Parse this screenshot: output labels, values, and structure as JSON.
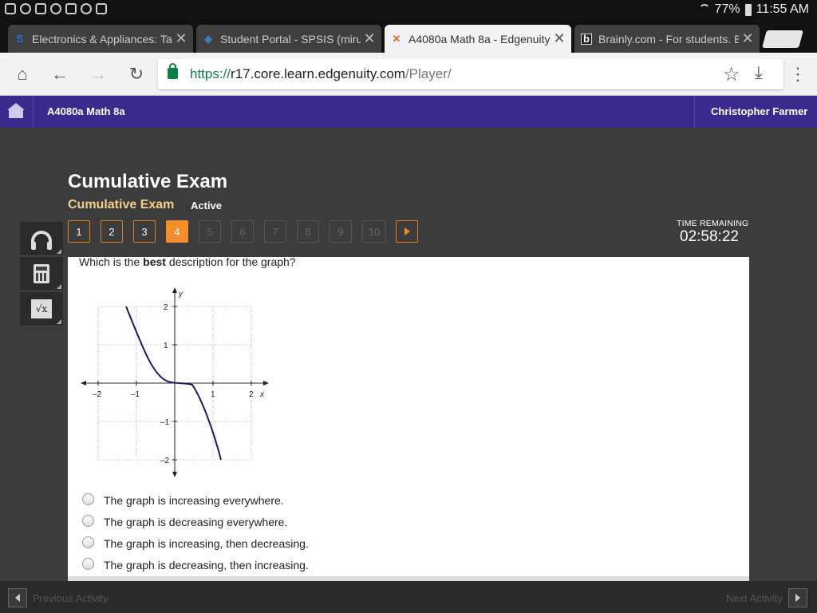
{
  "status_bar": {
    "battery": "77%",
    "time": "11:55 AM",
    "icons": [
      "notification-icon",
      "wrestling-app-icon",
      "gallery-icon",
      "game-icon",
      "flipboard-icon",
      "instagram-icon",
      "bag-icon"
    ]
  },
  "tabs": [
    {
      "title": "Electronics & Appliances: Ta",
      "favicon": "S",
      "active": false
    },
    {
      "title": "Student Portal - SPSIS (miru",
      "favicon": "shield",
      "active": false
    },
    {
      "title": "A4080a Math 8a - Edgenuity",
      "favicon": "X",
      "active": true
    },
    {
      "title": "Brainly.com - For students. B",
      "favicon": "b",
      "active": false
    }
  ],
  "address": {
    "protocol": "https://",
    "host": "r17.core.learn.edgenuity.com",
    "path": "/Player/"
  },
  "appbar": {
    "course": "A4080a Math 8a",
    "user": "Christopher Farmer"
  },
  "player": {
    "title": "Cumulative Exam",
    "subtitle": "Cumulative Exam",
    "status": "Active",
    "questions": [
      "1",
      "2",
      "3",
      "4",
      "5",
      "6",
      "7",
      "8",
      "9",
      "10"
    ],
    "current_question": 4,
    "answered_count": 3,
    "timer_label": "TIME REMAINING",
    "timer": "02:58:22"
  },
  "tools": [
    "headphones-icon",
    "calculator-icon",
    "formula-icon"
  ],
  "question": {
    "before": "Which is the ",
    "emphasis": "best",
    "after": " description for the graph?"
  },
  "graph": {
    "x_label": "x",
    "y_label": "y",
    "x_ticks": [
      "–2",
      "–1",
      "1",
      "2"
    ],
    "y_ticks": [
      "2",
      "1",
      "–1",
      "–2"
    ],
    "curve_color": "#1a1a5e"
  },
  "options": [
    "The graph is increasing everywhere.",
    "The graph is decreasing everywhere.",
    "The graph is increasing, then decreasing.",
    "The graph is decreasing, then increasing."
  ],
  "footer": {
    "previous": "Previous Activity",
    "next": "Next Activity"
  },
  "colors": {
    "appbar": "#3b2a8e",
    "accent": "#f28d2b",
    "subtitle": "#f3d08b"
  }
}
